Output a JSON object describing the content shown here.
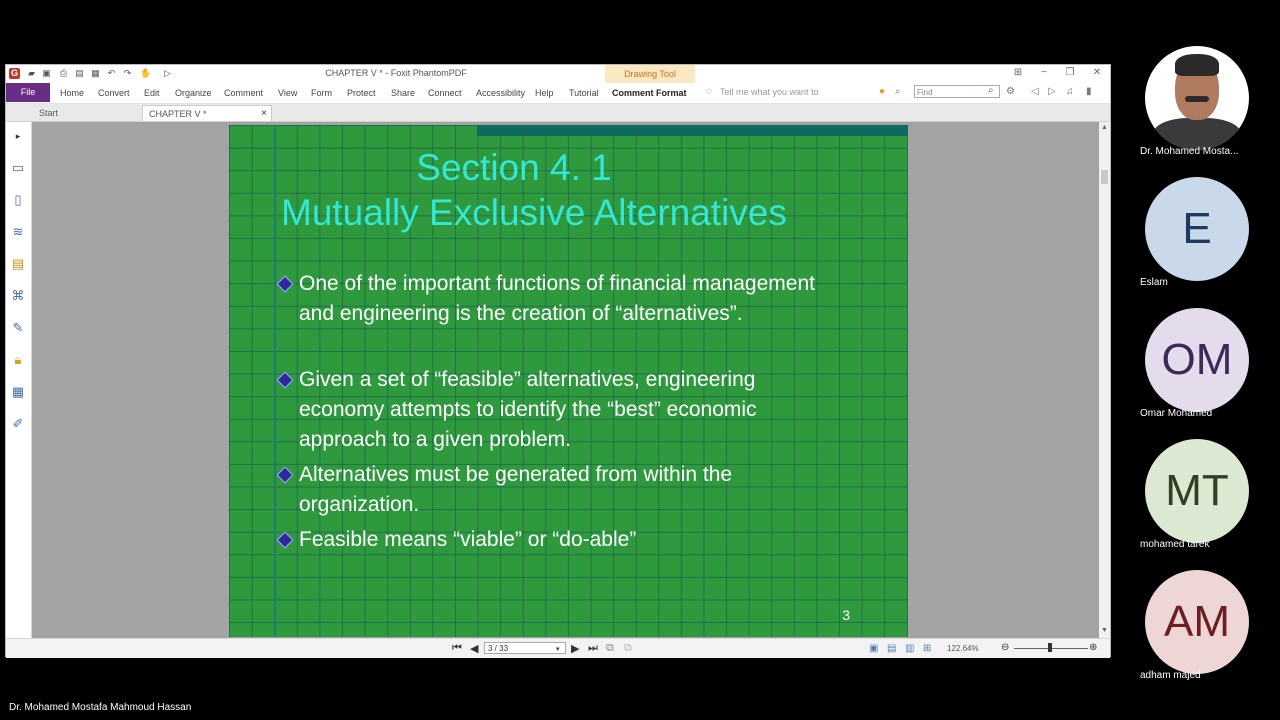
{
  "window": {
    "title": "CHAPTER V * - Foxit PhantomPDF",
    "context_tab": "Drawing Tool"
  },
  "ribbon": {
    "file": "File",
    "items": [
      "Home",
      "Convert",
      "Edit",
      "Organize",
      "Comment",
      "View",
      "Form",
      "Protect",
      "Share",
      "Connect",
      "Accessibility",
      "Help",
      "Tutorial",
      "Comment Format"
    ],
    "tell_me": "Tell me what you want to",
    "find_placeholder": "Find"
  },
  "tabs": {
    "start": "Start",
    "doc": "CHAPTER V *",
    "close": "×"
  },
  "slide": {
    "title_line1": "Section 4. 1",
    "title_line2": "Mutually Exclusive Alternatives",
    "bullets": [
      "One of the important functions of financial management and engineering is the creation of “alternatives”.",
      "Given a set of “feasible” alternatives, engineering economy attempts to identify the “best” economic approach to a given problem.",
      "Alternatives must be generated from within the organization.",
      "Feasible means “viable” or “do-able”"
    ],
    "page_number": "3"
  },
  "statusbar": {
    "page_indicator": "3 / 33",
    "zoom": "122.64%"
  },
  "participants": [
    {
      "name": "Dr. Mohamed Mosta...",
      "initials": "",
      "bg": "#ffffff",
      "fg": "#000000"
    },
    {
      "name": "Eslam",
      "initials": "E",
      "bg": "#c9d9ea",
      "fg": "#1e3a5f"
    },
    {
      "name": "Omar Mohamed",
      "initials": "OM",
      "bg": "#e4dbec",
      "fg": "#3b2a55"
    },
    {
      "name": "mohamed tarek",
      "initials": "MT",
      "bg": "#dde8d3",
      "fg": "#2f4025"
    },
    {
      "name": "adham majed",
      "initials": "AM",
      "bg": "#efd6d6",
      "fg": "#6b1f24"
    }
  ],
  "presenter_name": "Dr. Mohamed Mostafa Mahmoud Hassan",
  "colors": {
    "slide_bg": "#2f9a3d",
    "title": "#33e6d6",
    "file_tab": "#6a2d86"
  }
}
